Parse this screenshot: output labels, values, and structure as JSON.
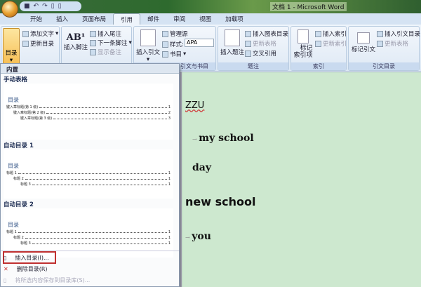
{
  "window": {
    "title": "文档 1 - Microsoft Word"
  },
  "tabs": [
    "开始",
    "插入",
    "页面布局",
    "引用",
    "邮件",
    "审阅",
    "视图",
    "加载项"
  ],
  "ribbon": {
    "toc": {
      "label": "目录",
      "add_text": "添加文字",
      "update": "更新目录"
    },
    "footnotes": {
      "insert_footnote": "插入脚注",
      "insert_endnote": "插入尾注",
      "next_footnote": "下一条脚注",
      "show_notes": "显示备注"
    },
    "citations": {
      "insert_citation": "插入引文",
      "manage_sources": "管理源",
      "style_label": "样式:",
      "style_value": "APA",
      "bibliography": "书目",
      "group": "引文与书目"
    },
    "captions": {
      "insert_caption": "插入题注",
      "insert_table_of_figures": "插入图表目录",
      "update_table": "更新表格",
      "cross_reference": "交叉引用",
      "group": "题注"
    },
    "index": {
      "mark_entry": "标记索引项",
      "mark_entry_line1": "标记",
      "mark_entry_line2": "索引项",
      "insert_index": "插入索引",
      "update_index": "更新索引",
      "group": "索引"
    },
    "authorities": {
      "mark_citation": "标记引文",
      "insert_toa": "插入引文目录",
      "update_table": "更新表格",
      "group": "引文目录"
    }
  },
  "menu": {
    "header": "内置",
    "sections": [
      {
        "title": "手动表格",
        "preview_title": "目录",
        "lines": [
          {
            "text": "键入章标题(第 1 级)",
            "page": "1"
          },
          {
            "text": "键入章标题(第 2 级)",
            "page": "2"
          },
          {
            "text": "键入章标题(第 3 级)",
            "page": "3"
          }
        ]
      },
      {
        "title": "自动目录 1",
        "preview_title": "目录",
        "lines": [
          {
            "text": "标题 1",
            "page": "1"
          },
          {
            "text": "标题 2",
            "page": "1"
          },
          {
            "text": "标题 3",
            "page": "1"
          }
        ]
      },
      {
        "title": "自动目录 2",
        "preview_title": "目录",
        "lines": [
          {
            "text": "标题 1",
            "page": "1"
          },
          {
            "text": "标题 2",
            "page": "1"
          },
          {
            "text": "标题 3",
            "page": "1"
          }
        ]
      }
    ],
    "insert_toc": "插入目录(I)...",
    "remove_toc": "删除目录(R)",
    "save_selection": "将所选内容保存到目录库(S)..."
  },
  "document": {
    "lines": [
      "ZZU",
      "my school",
      "day",
      "new school",
      "you"
    ]
  }
}
